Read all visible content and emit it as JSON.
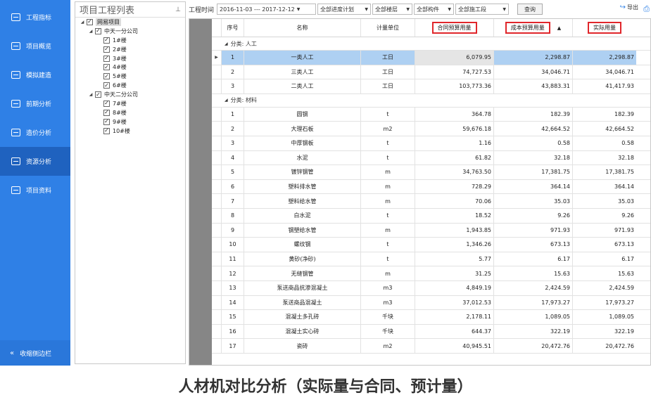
{
  "sidebar": {
    "items": [
      {
        "label": "工程指标",
        "icon": "chart-icon",
        "active": false
      },
      {
        "label": "项目概览",
        "icon": "trend-icon",
        "active": false
      },
      {
        "label": "模拟建造",
        "icon": "building-icon",
        "active": false
      },
      {
        "label": "前期分析",
        "icon": "analysis-icon",
        "active": false
      },
      {
        "label": "造价分析",
        "icon": "cost-icon",
        "active": false
      },
      {
        "label": "资源分析",
        "icon": "resource-icon",
        "active": true
      },
      {
        "label": "项目资料",
        "icon": "document-icon",
        "active": false
      }
    ],
    "collapse_label": "收缩侧边栏",
    "colors": {
      "background": "#2f80e6",
      "active": "#1f62bf"
    }
  },
  "tree": {
    "title": "项目工程列表",
    "root": "网易项目",
    "companies": [
      {
        "name": "中天一分公司",
        "buildings": [
          "1#楼",
          "2#楼",
          "3#楼",
          "4#楼",
          "5#楼",
          "6#楼"
        ]
      },
      {
        "name": "中天二分公司",
        "buildings": [
          "7#楼",
          "8#楼",
          "9#楼",
          "10#楼"
        ]
      }
    ]
  },
  "toolbar": {
    "time_label": "工程时间",
    "date_range": "2016-11-03 --- 2017-12-12",
    "filters": [
      "全部进度计划",
      "全部楼层",
      "全部构件",
      "全部施工段"
    ],
    "query_label": "查询",
    "export_label": "导出"
  },
  "table": {
    "columns": {
      "seq": "序号",
      "name": "名称",
      "unit": "计量单位",
      "contract": "合同预算用量",
      "cost": "成本预算用量",
      "actual": "实际用量"
    },
    "highlight_color": "#e0262b",
    "groups": [
      {
        "label": "分类: 人工",
        "rows": [
          {
            "seq": "1",
            "name": "一类人工",
            "unit": "工日",
            "contract": "6,079.95",
            "cost": "2,298.87",
            "actual": "2,298.87",
            "selected": true
          },
          {
            "seq": "2",
            "name": "三类人工",
            "unit": "工日",
            "contract": "74,727.53",
            "cost": "34,046.71",
            "actual": "34,046.71"
          },
          {
            "seq": "3",
            "name": "二类人工",
            "unit": "工日",
            "contract": "103,773.36",
            "cost": "43,883.31",
            "actual": "41,417.93"
          }
        ]
      },
      {
        "label": "分类: 材料",
        "rows": [
          {
            "seq": "1",
            "name": "圆钢",
            "unit": "t",
            "contract": "364.78",
            "cost": "182.39",
            "actual": "182.39"
          },
          {
            "seq": "2",
            "name": "大理石板",
            "unit": "m2",
            "contract": "59,676.18",
            "cost": "42,664.52",
            "actual": "42,664.52"
          },
          {
            "seq": "3",
            "name": "中厚钢板",
            "unit": "t",
            "contract": "1.16",
            "cost": "0.58",
            "actual": "0.58"
          },
          {
            "seq": "4",
            "name": "水泥",
            "unit": "t",
            "contract": "61.82",
            "cost": "32.18",
            "actual": "32.18"
          },
          {
            "seq": "5",
            "name": "镀锌钢管",
            "unit": "m",
            "contract": "34,763.50",
            "cost": "17,381.75",
            "actual": "17,381.75"
          },
          {
            "seq": "6",
            "name": "塑料排水管",
            "unit": "m",
            "contract": "728.29",
            "cost": "364.14",
            "actual": "364.14"
          },
          {
            "seq": "7",
            "name": "塑料给水管",
            "unit": "m",
            "contract": "70.06",
            "cost": "35.03",
            "actual": "35.03"
          },
          {
            "seq": "8",
            "name": "白水泥",
            "unit": "t",
            "contract": "18.52",
            "cost": "9.26",
            "actual": "9.26"
          },
          {
            "seq": "9",
            "name": "钢塑给水管",
            "unit": "m",
            "contract": "1,943.85",
            "cost": "971.93",
            "actual": "971.93"
          },
          {
            "seq": "10",
            "name": "螺纹钢",
            "unit": "t",
            "contract": "1,346.26",
            "cost": "673.13",
            "actual": "673.13"
          },
          {
            "seq": "11",
            "name": "黄砂(净砂)",
            "unit": "t",
            "contract": "5.77",
            "cost": "6.17",
            "actual": "6.17"
          },
          {
            "seq": "12",
            "name": "无缝钢管",
            "unit": "m",
            "contract": "31.25",
            "cost": "15.63",
            "actual": "15.63"
          },
          {
            "seq": "13",
            "name": "泵送商品抗渗混凝土",
            "unit": "m3",
            "contract": "4,849.19",
            "cost": "2,424.59",
            "actual": "2,424.59"
          },
          {
            "seq": "14",
            "name": "泵送商品混凝土",
            "unit": "m3",
            "contract": "37,012.53",
            "cost": "17,973.27",
            "actual": "17,973.27"
          },
          {
            "seq": "15",
            "name": "混凝土多孔砖",
            "unit": "千块",
            "contract": "2,178.11",
            "cost": "1,089.05",
            "actual": "1,089.05"
          },
          {
            "seq": "16",
            "name": "混凝土实心砖",
            "unit": "千块",
            "contract": "644.37",
            "cost": "322.19",
            "actual": "322.19"
          },
          {
            "seq": "17",
            "name": "瓷砖",
            "unit": "m2",
            "contract": "40,945.51",
            "cost": "20,472.76",
            "actual": "20,472.76"
          }
        ]
      }
    ]
  },
  "caption": "人材机对比分析（实际量与合同、预计量）"
}
